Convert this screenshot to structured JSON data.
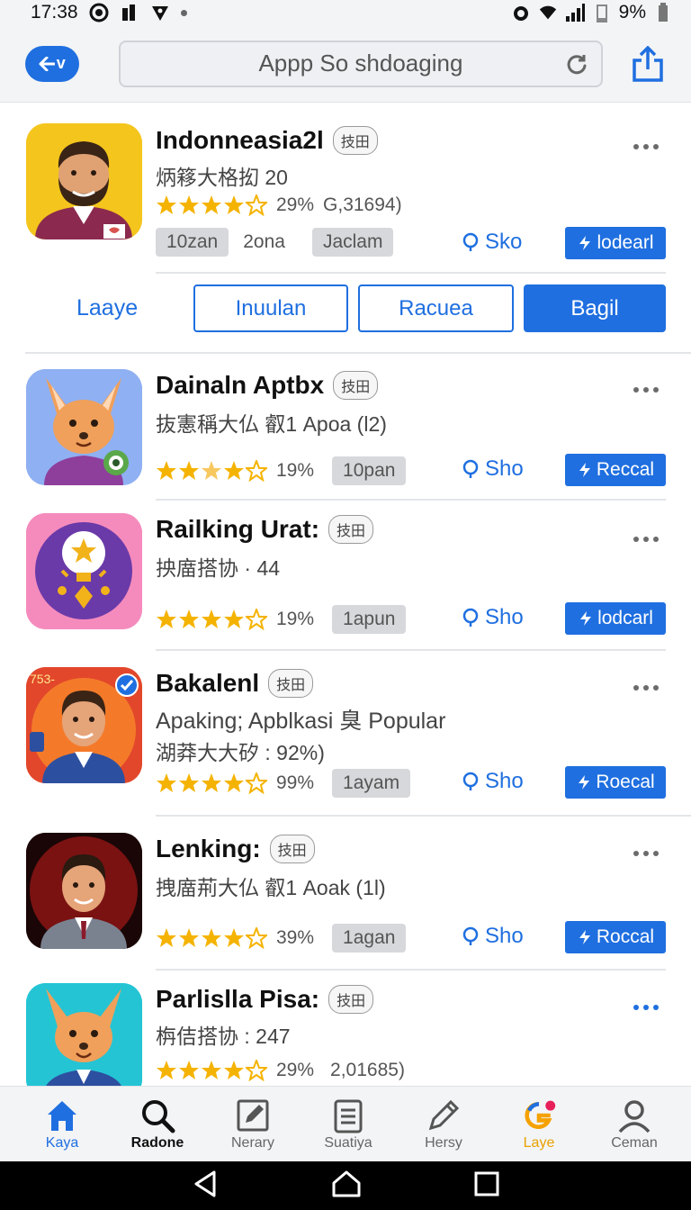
{
  "status_bar": {
    "time": "17:38",
    "battery": "9%"
  },
  "top_bar": {
    "back_label": "v",
    "search_text": "Appp So shdoaging"
  },
  "segment": {
    "label": "Laaye",
    "buttons": [
      "Inuulan",
      "Racuea",
      "Bagil"
    ],
    "active_index": 2
  },
  "apps": [
    {
      "title": "Indonneasia2l",
      "tag": "技田",
      "sub": "炳簃大格抝 20",
      "rating_pct": "29%",
      "extra": "G,31694)",
      "pills": [
        "10zan",
        "2ona",
        "Jaclam"
      ],
      "sho": "Sko",
      "action": "lodearl"
    },
    {
      "title": "Dainaln Aptbx",
      "tag": "技田",
      "sub": "抜憲稱大仏 叡1 Apoa (l2)",
      "rating_pct": "19%",
      "pill": "10pan",
      "sho": "Sho",
      "action": "Reccal"
    },
    {
      "title": "Railking Urat:",
      "tag": "技田",
      "sub": "抰庿搭协 · 44",
      "rating_pct": "19%",
      "pill": "1apun",
      "sho": "Sho",
      "action": "lodcarl"
    },
    {
      "title": "Bakalenl",
      "tag": "技田",
      "sub": "Apaking; Apblkasi 臭 Popular",
      "sub2": "湖莽大大矽 : 92%)",
      "rating_pct": "99%",
      "pill": "1ayam",
      "sho": "Sho",
      "action": "Rоecal",
      "badge": "753-"
    },
    {
      "title": "Lenking:",
      "tag": "技田",
      "sub": "拽庿荊大仏 叡1 Aoak (1l)",
      "rating_pct": "39%",
      "pill": "1agan",
      "sho": "Sho",
      "action": "Roccal"
    },
    {
      "title": "Parlislla Pisa:",
      "tag": "技田",
      "sub": "栴佶搭协 : 247",
      "rating_pct": "29%",
      "extra": "2,01685)"
    }
  ],
  "bottom_nav": [
    {
      "label": "Kaya",
      "icon": "home-icon"
    },
    {
      "label": "Radone",
      "icon": "search-icon"
    },
    {
      "label": "Nerary",
      "icon": "edit-icon"
    },
    {
      "label": "Suatiya",
      "icon": "document-icon"
    },
    {
      "label": "Hersy",
      "icon": "pen-icon"
    },
    {
      "label": "Laye",
      "icon": "games-icon"
    },
    {
      "label": "Ceman",
      "icon": "person-icon"
    }
  ],
  "colors": {
    "accent": "#1f6fe0",
    "star": "#f5b301",
    "games": "#e8a100"
  }
}
